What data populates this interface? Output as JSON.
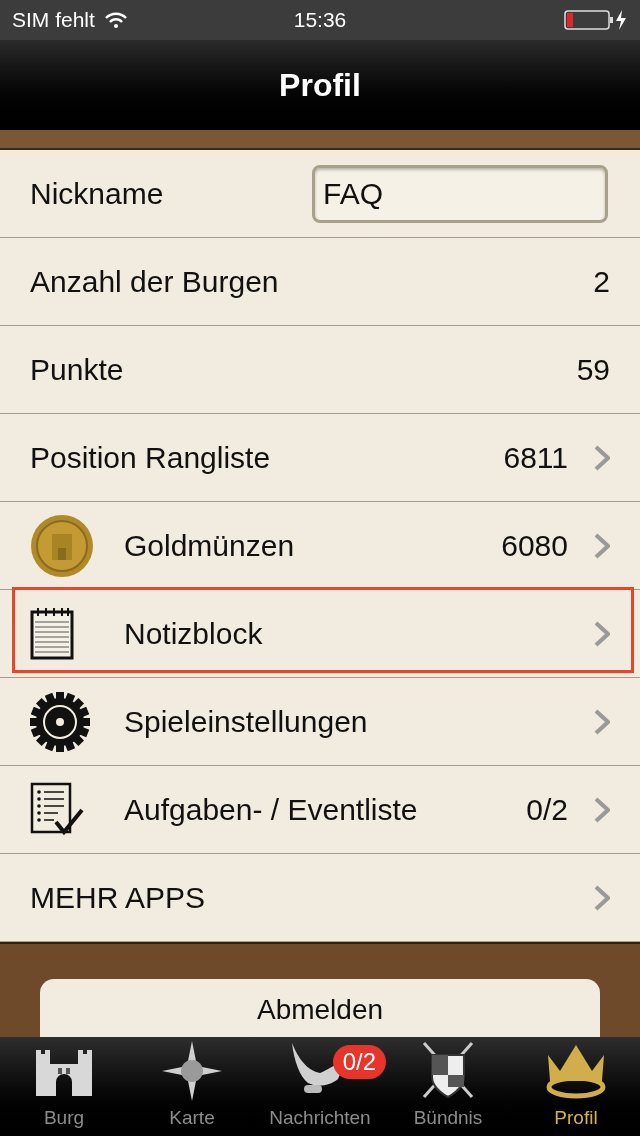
{
  "status_bar": {
    "carrier": "SIM fehlt",
    "time": "15:36"
  },
  "nav_bar": {
    "title": "Profil"
  },
  "rows": [
    {
      "kind": "field",
      "label": "Nickname",
      "value": "FAQ"
    },
    {
      "kind": "value",
      "label": "Anzahl der Burgen",
      "value": "2"
    },
    {
      "kind": "value",
      "label": "Punkte",
      "value": "59"
    },
    {
      "kind": "link",
      "label": "Position Rangliste",
      "value": "6811",
      "highlighted": false
    },
    {
      "kind": "link",
      "label": "Goldmünzen",
      "value": "6080",
      "highlighted": false
    },
    {
      "kind": "link",
      "label": "Notizblock",
      "highlighted": true
    },
    {
      "kind": "link",
      "label": "Spieleinstellungen",
      "highlighted": false
    },
    {
      "kind": "link",
      "label": "Aufgaben- / Eventliste",
      "value": "0/2",
      "highlighted": false
    },
    {
      "kind": "link",
      "label": "MEHR APPS",
      "highlighted": false
    }
  ],
  "logout_button": "Abmelden",
  "tab_bar": [
    {
      "label": "Burg",
      "selected": false
    },
    {
      "label": "Karte",
      "selected": false
    },
    {
      "label": "Nachrichten",
      "badge": "0/2",
      "selected": false
    },
    {
      "label": "Bündnis",
      "selected": false
    },
    {
      "label": "Profil",
      "selected": true
    }
  ]
}
